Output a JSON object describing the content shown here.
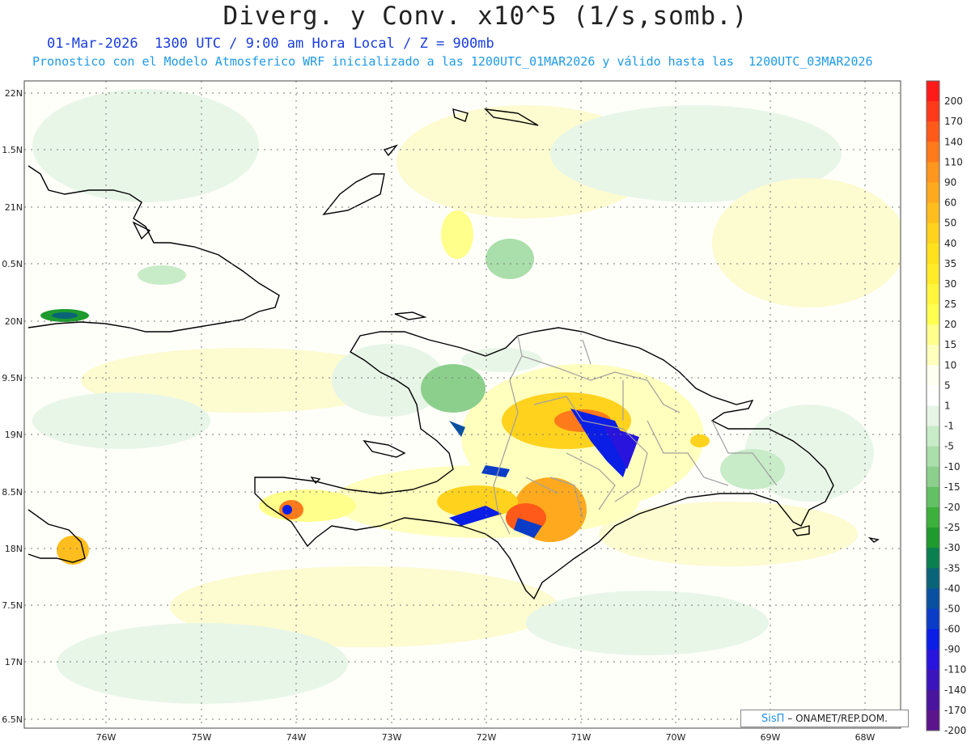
{
  "title": "Diverg. y Conv. x10^5 (1/s,somb.)",
  "subtitle": "01-Mar-2026  1300 UTC / 9:00 am Hora Local / Z = 900mb",
  "forecast_note": "Pronostico con el Modelo Atmosferico WRF inicializado a las 1200UTC_01MAR2026 y válido hasta las  1200UTC_03MAR2026",
  "lat_labels": [
    "22N",
    "1.5N",
    "21N",
    "0.5N",
    "20N",
    "9.5N",
    "19N",
    "8.5N",
    "18N",
    "7.5N",
    "17N",
    "6.5N"
  ],
  "lon_labels": [
    "76W",
    "75W",
    "74W",
    "73W",
    "72W",
    "71W",
    "70W",
    "69W",
    "68W"
  ],
  "colorbar": {
    "labels": [
      "200",
      "170",
      "140",
      "110",
      "90",
      "60",
      "50",
      "40",
      "35",
      "30",
      "25",
      "20",
      "15",
      "10",
      "5",
      "1",
      "-1",
      "-5",
      "-10",
      "-15",
      "-20",
      "-25",
      "-30",
      "-35",
      "-40",
      "-50",
      "-60",
      "-90",
      "-110",
      "-140",
      "-170",
      "-200"
    ],
    "colors": [
      "#ff1a1a",
      "#ff3a1a",
      "#ff5a1a",
      "#ff7a1a",
      "#ff961e",
      "#ffaa1e",
      "#ffbe1e",
      "#ffd21e",
      "#ffe11e",
      "#ffeb28",
      "#fff53c",
      "#ffff50",
      "#ffff8c",
      "#ffffbe",
      "#fffff0",
      "#ffffff",
      "#e6f5e6",
      "#c8ebc8",
      "#aadeaa",
      "#8ccf8c",
      "#64c064",
      "#3caf3c",
      "#1e9a2e",
      "#0a8050",
      "#0a6478",
      "#0a50a0",
      "#0a3cc8",
      "#0a1ee6",
      "#2814dc",
      "#3c14be",
      "#4a149f",
      "#5a148c"
    ]
  },
  "credit": {
    "brand": "SisΠ",
    "org": " – ONAMET/REP.DOM."
  }
}
